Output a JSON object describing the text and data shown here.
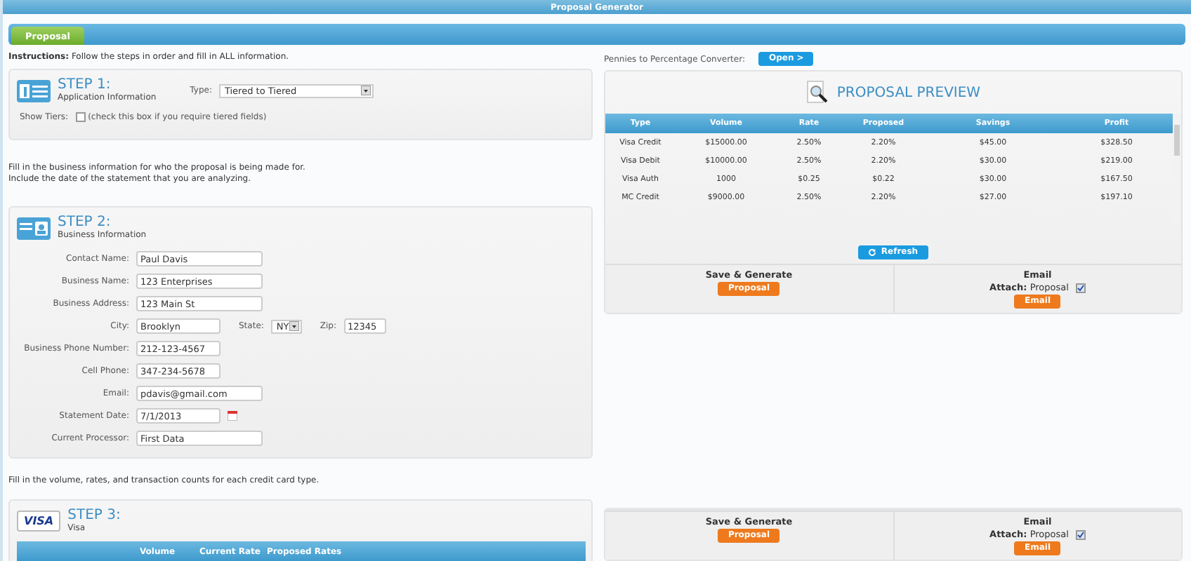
{
  "window": {
    "title": "Proposal Generator"
  },
  "tabs": [
    {
      "label": "Proposal",
      "selected": true
    }
  ],
  "instructions": "**Instructions:** Follow the steps in order and fill in ALL information.",
  "step1": {
    "title": "STEP 1:",
    "subtitle": "Application Information",
    "type_label": "Type:",
    "type_value": "Tiered to Tiered",
    "show_tiers_label": "Show Tiers:",
    "show_tiers_checked": false,
    "show_tiers_hint": "(check this box if you require tiered fields)"
  },
  "step2_intro": [
    "Fill in the business information for who the proposal is being made for.",
    "Include the date of the statement that you are analyzing."
  ],
  "step2": {
    "title": "STEP 2:",
    "subtitle": "Business Information",
    "rows": [
      [
        {
          "label": "Contact Name:",
          "value": "Paul Davis",
          "kind": "wide"
        }
      ],
      [
        {
          "label": "Business Name:",
          "value": "123 Enterprises",
          "kind": "wide"
        }
      ],
      [
        {
          "label": "Business Address:",
          "value": "123 Main St",
          "kind": "wide"
        }
      ],
      [
        {
          "label": "City:",
          "value": "Brooklyn",
          "kind": "short"
        },
        {
          "label": "State:",
          "value": "NY",
          "kind": "select"
        },
        {
          "label": "Zip:",
          "value": "12345",
          "kind": "tiny"
        }
      ],
      [
        {
          "label": "Business Phone Number:",
          "value": "212-123-4567",
          "kind": "short"
        }
      ],
      [
        {
          "label": "Cell Phone:",
          "value": "347-234-5678",
          "kind": "short"
        }
      ],
      [
        {
          "label": "Email:",
          "value": "pdavis@gmail.com",
          "kind": "wide"
        }
      ],
      [
        {
          "label": "Statement Date:",
          "value": "7/1/2013",
          "kind": "date"
        }
      ],
      [
        {
          "label": "Current Processor:",
          "value": "First Data",
          "kind": "wide"
        }
      ]
    ]
  },
  "step3_intro": "Fill in the volume, rates, and transaction counts for each credit card type.",
  "step3": {
    "logo": "VISA",
    "title": "STEP 3:",
    "subtitle": "Visa",
    "columns": [
      "Volume",
      "Current Rate",
      "Proposed Rates"
    ]
  },
  "converter": {
    "label": "Pennies to Percentage Converter:",
    "button": "Open >"
  },
  "preview": {
    "title": "PROPOSAL PREVIEW",
    "columns": [
      "Type",
      "Volume",
      "Rate",
      "Proposed",
      "Savings",
      "Profit"
    ],
    "rows": [
      [
        "Visa Credit",
        "$15000.00",
        "2.50%",
        "2.20%",
        "$45.00",
        "$328.50"
      ],
      [
        "Visa Debit",
        "$10000.00",
        "2.50%",
        "2.20%",
        "$30.00",
        "$219.00"
      ],
      [
        "Visa Auth",
        "1000",
        "$0.25",
        "$0.22",
        "$30.00",
        "$167.50"
      ],
      [
        "MC Credit",
        "$9000.00",
        "2.50%",
        "2.20%",
        "$27.00",
        "$197.10"
      ]
    ],
    "refresh": "Refresh"
  },
  "actions": [
    {
      "save_title": "Save & Generate",
      "save_button": "Proposal",
      "email_title": "Email",
      "attach_label": "Attach:",
      "attach_value": "Proposal",
      "attach_checked": true,
      "email_button": "Email"
    },
    {
      "save_title": "Save & Generate",
      "save_button": "Proposal",
      "email_title": "Email",
      "attach_label": "Attach:",
      "attach_value": "Proposal",
      "attach_checked": true,
      "email_button": "Email"
    }
  ]
}
